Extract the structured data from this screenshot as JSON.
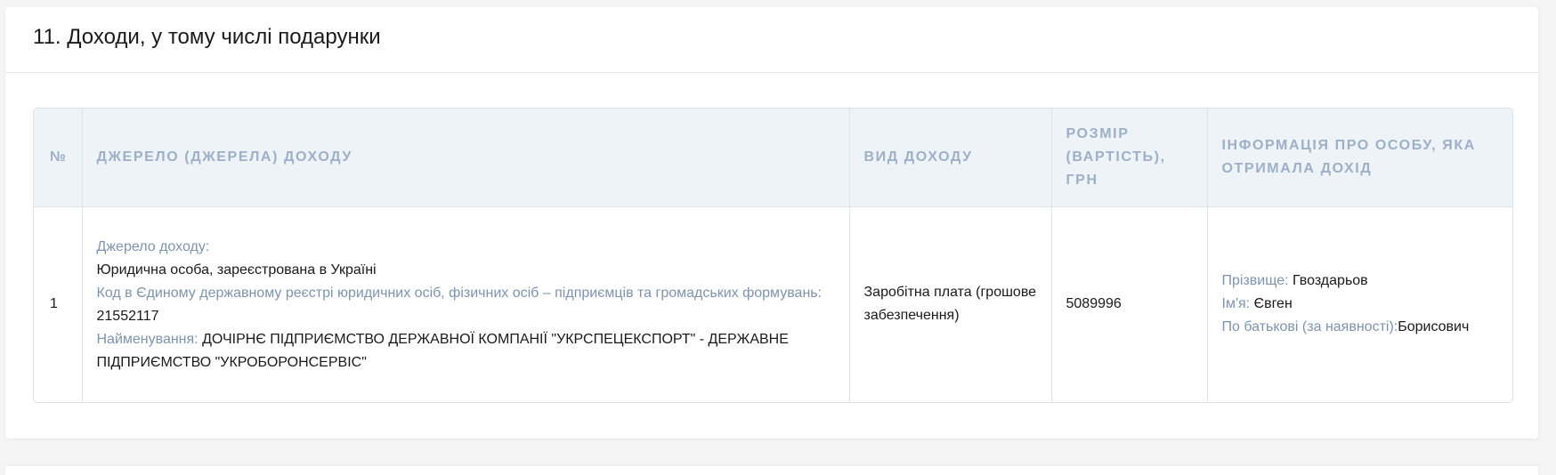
{
  "section": {
    "title": "11. Доходи, у тому числі подарунки"
  },
  "table": {
    "headers": {
      "number": "№",
      "source": "Джерело (джерела) доходу",
      "kind": "Вид доходу",
      "amount": "Розмір (вартість), грн",
      "person": "Інформація про особу, яка отримала дохід"
    },
    "rows": [
      {
        "number": "1",
        "source_label": "Джерело доходу:",
        "source_value": "Юридична особа, зареєстрована в Україні",
        "code_label": "Код в Єдиному державному реєстрі юридичних осіб, фізичних осіб – підприємців та громадських формувань:",
        "code_value": "21552117",
        "name_label": "Найменування:",
        "name_value": "ДОЧІРНЄ ПІДПРИЄМСТВО ДЕРЖАВНОЇ КОМПАНІЇ \"УКРСПЕЦЕКСПОРТ\" - ДЕРЖАВНЕ ПІДПРИЄМСТВО \"УКРОБОРОНСЕРВІС\"",
        "kind": "Заробітна плата (грошове забезпечення)",
        "amount": "5089996",
        "surname_label": "Прізвище:",
        "surname_value": "Гвоздарьов",
        "firstname_label": "Ім'я:",
        "firstname_value": "Євген",
        "patronymic_label": "По батькові (за наявності):",
        "patronymic_value": "Борисович"
      }
    ]
  }
}
